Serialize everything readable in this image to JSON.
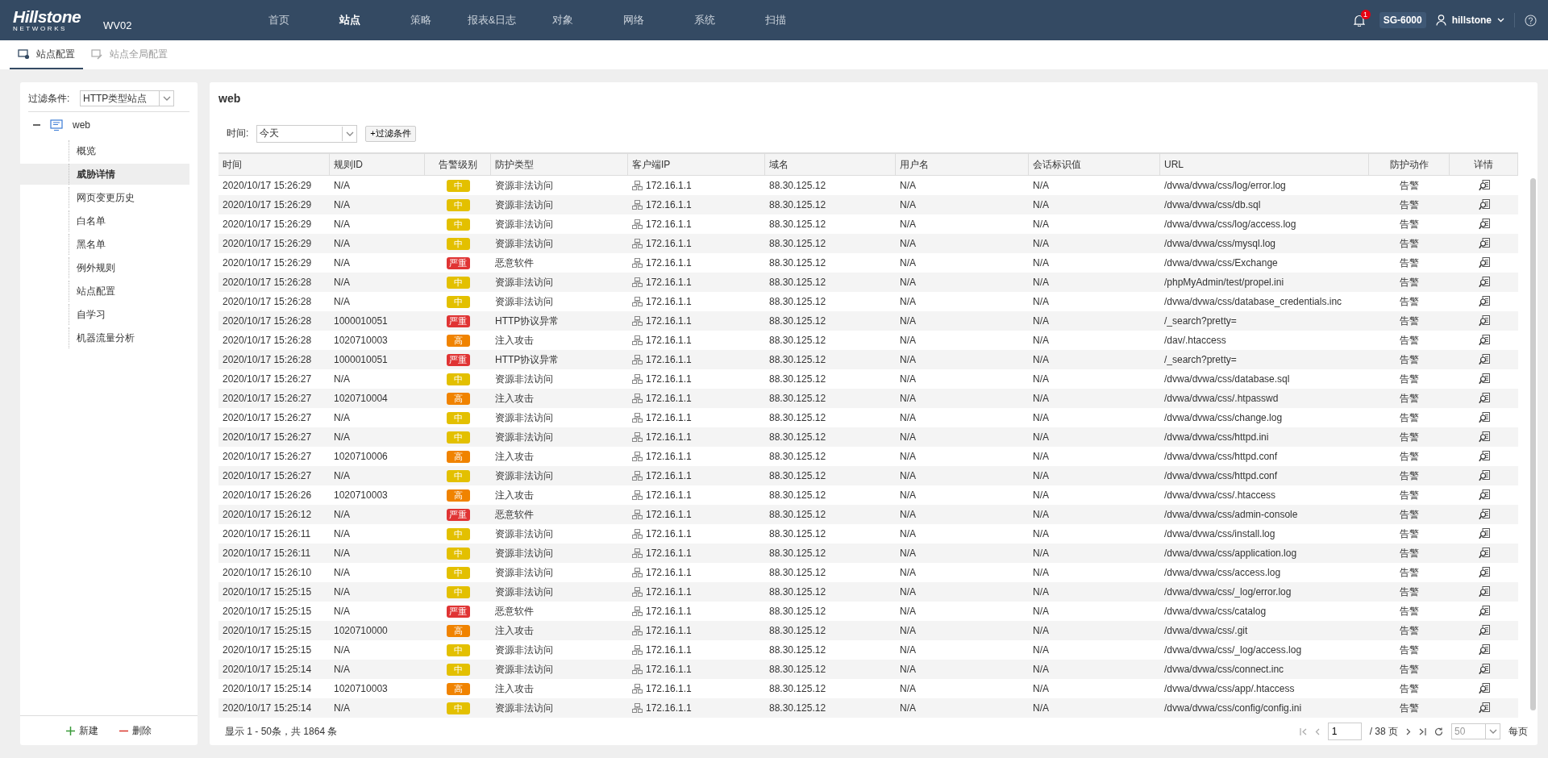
{
  "header": {
    "logo": "Hillstone",
    "logo_sub": "NETWORKS",
    "device": "WV02",
    "nav": [
      {
        "label": "首页",
        "selected": false
      },
      {
        "label": "站点",
        "selected": true
      },
      {
        "label": "策略",
        "selected": false
      },
      {
        "label": "报表&日志",
        "selected": false
      },
      {
        "label": "对象",
        "selected": false
      },
      {
        "label": "网络",
        "selected": false
      },
      {
        "label": "系统",
        "selected": false
      },
      {
        "label": "扫描",
        "selected": false
      }
    ],
    "notification_count": "1",
    "model": "SG-6000",
    "user": "hillstone"
  },
  "tabs": [
    {
      "label": "站点配置",
      "selected": true
    },
    {
      "label": "站点全局配置",
      "selected": false
    }
  ],
  "sidebar": {
    "filter_label": "过滤条件:",
    "filter_value": "HTTP类型站点",
    "tree": [
      {
        "label": "web",
        "expanded": true,
        "children": [
          {
            "label": "概览",
            "selected": false
          },
          {
            "label": "威胁详情",
            "selected": true
          },
          {
            "label": "网页变更历史",
            "selected": false
          },
          {
            "label": "白名单",
            "selected": false
          },
          {
            "label": "黑名单",
            "selected": false
          },
          {
            "label": "例外规则",
            "selected": false
          },
          {
            "label": "站点配置",
            "selected": false
          },
          {
            "label": "自学习",
            "selected": false
          },
          {
            "label": "机器流量分析",
            "selected": false
          }
        ]
      }
    ],
    "actions": [
      "新建",
      "删除"
    ]
  },
  "main": {
    "title": "web",
    "time_label": "时间:",
    "time_value": "今天",
    "add_filter": "+过滤条件",
    "table": {
      "columns": [
        "时间",
        "规则ID",
        "告警级别",
        "防护类型",
        "客户端IP",
        "域名",
        "用户名",
        "会话标识值",
        "URL",
        "防护动作",
        "详情"
      ],
      "rows": [
        {
          "time": "2020/10/17 15:26:29",
          "rule_id": "N/A",
          "alert": {
            "label": "中",
            "color": "#e3c000"
          },
          "type": "资源非法访问",
          "ip": "172.16.1.1",
          "domain": "88.30.125.12",
          "user": "N/A",
          "session": "N/A",
          "url": "/dvwa/dvwa/css/log/error.log",
          "action": "告警"
        },
        {
          "time": "2020/10/17 15:26:29",
          "rule_id": "N/A",
          "alert": {
            "label": "中",
            "color": "#e3c000"
          },
          "type": "资源非法访问",
          "ip": "172.16.1.1",
          "domain": "88.30.125.12",
          "user": "N/A",
          "session": "N/A",
          "url": "/dvwa/dvwa/css/db.sql",
          "action": "告警"
        },
        {
          "time": "2020/10/17 15:26:29",
          "rule_id": "N/A",
          "alert": {
            "label": "中",
            "color": "#e3c000"
          },
          "type": "资源非法访问",
          "ip": "172.16.1.1",
          "domain": "88.30.125.12",
          "user": "N/A",
          "session": "N/A",
          "url": "/dvwa/dvwa/css/log/access.log",
          "action": "告警"
        },
        {
          "time": "2020/10/17 15:26:29",
          "rule_id": "N/A",
          "alert": {
            "label": "中",
            "color": "#e3c000"
          },
          "type": "资源非法访问",
          "ip": "172.16.1.1",
          "domain": "88.30.125.12",
          "user": "N/A",
          "session": "N/A",
          "url": "/dvwa/dvwa/css/mysql.log",
          "action": "告警"
        },
        {
          "time": "2020/10/17 15:26:29",
          "rule_id": "N/A",
          "alert": {
            "label": "严重",
            "color": "#e03434"
          },
          "type": "恶意软件",
          "ip": "172.16.1.1",
          "domain": "88.30.125.12",
          "user": "N/A",
          "session": "N/A",
          "url": "/dvwa/dvwa/css/Exchange",
          "action": "告警"
        },
        {
          "time": "2020/10/17 15:26:28",
          "rule_id": "N/A",
          "alert": {
            "label": "中",
            "color": "#e3c000"
          },
          "type": "资源非法访问",
          "ip": "172.16.1.1",
          "domain": "88.30.125.12",
          "user": "N/A",
          "session": "N/A",
          "url": "/phpMyAdmin/test/propel.ini",
          "action": "告警"
        },
        {
          "time": "2020/10/17 15:26:28",
          "rule_id": "N/A",
          "alert": {
            "label": "中",
            "color": "#e3c000"
          },
          "type": "资源非法访问",
          "ip": "172.16.1.1",
          "domain": "88.30.125.12",
          "user": "N/A",
          "session": "N/A",
          "url": "/dvwa/dvwa/css/database_credentials.inc",
          "action": "告警"
        },
        {
          "time": "2020/10/17 15:26:28",
          "rule_id": "1000010051",
          "alert": {
            "label": "严重",
            "color": "#e03434"
          },
          "type": "HTTP协议异常",
          "ip": "172.16.1.1",
          "domain": "88.30.125.12",
          "user": "N/A",
          "session": "N/A",
          "url": "/_search?pretty=",
          "action": "告警"
        },
        {
          "time": "2020/10/17 15:26:28",
          "rule_id": "1020710003",
          "alert": {
            "label": "高",
            "color": "#f08300"
          },
          "type": "注入攻击",
          "ip": "172.16.1.1",
          "domain": "88.30.125.12",
          "user": "N/A",
          "session": "N/A",
          "url": "/dav/.htaccess",
          "action": "告警"
        },
        {
          "time": "2020/10/17 15:26:28",
          "rule_id": "1000010051",
          "alert": {
            "label": "严重",
            "color": "#e03434"
          },
          "type": "HTTP协议异常",
          "ip": "172.16.1.1",
          "domain": "88.30.125.12",
          "user": "N/A",
          "session": "N/A",
          "url": "/_search?pretty=",
          "action": "告警"
        },
        {
          "time": "2020/10/17 15:26:27",
          "rule_id": "N/A",
          "alert": {
            "label": "中",
            "color": "#e3c000"
          },
          "type": "资源非法访问",
          "ip": "172.16.1.1",
          "domain": "88.30.125.12",
          "user": "N/A",
          "session": "N/A",
          "url": "/dvwa/dvwa/css/database.sql",
          "action": "告警"
        },
        {
          "time": "2020/10/17 15:26:27",
          "rule_id": "1020710004",
          "alert": {
            "label": "高",
            "color": "#f08300"
          },
          "type": "注入攻击",
          "ip": "172.16.1.1",
          "domain": "88.30.125.12",
          "user": "N/A",
          "session": "N/A",
          "url": "/dvwa/dvwa/css/.htpasswd",
          "action": "告警"
        },
        {
          "time": "2020/10/17 15:26:27",
          "rule_id": "N/A",
          "alert": {
            "label": "中",
            "color": "#e3c000"
          },
          "type": "资源非法访问",
          "ip": "172.16.1.1",
          "domain": "88.30.125.12",
          "user": "N/A",
          "session": "N/A",
          "url": "/dvwa/dvwa/css/change.log",
          "action": "告警"
        },
        {
          "time": "2020/10/17 15:26:27",
          "rule_id": "N/A",
          "alert": {
            "label": "中",
            "color": "#e3c000"
          },
          "type": "资源非法访问",
          "ip": "172.16.1.1",
          "domain": "88.30.125.12",
          "user": "N/A",
          "session": "N/A",
          "url": "/dvwa/dvwa/css/httpd.ini",
          "action": "告警"
        },
        {
          "time": "2020/10/17 15:26:27",
          "rule_id": "1020710006",
          "alert": {
            "label": "高",
            "color": "#f08300"
          },
          "type": "注入攻击",
          "ip": "172.16.1.1",
          "domain": "88.30.125.12",
          "user": "N/A",
          "session": "N/A",
          "url": "/dvwa/dvwa/css/httpd.conf",
          "action": "告警"
        },
        {
          "time": "2020/10/17 15:26:27",
          "rule_id": "N/A",
          "alert": {
            "label": "中",
            "color": "#e3c000"
          },
          "type": "资源非法访问",
          "ip": "172.16.1.1",
          "domain": "88.30.125.12",
          "user": "N/A",
          "session": "N/A",
          "url": "/dvwa/dvwa/css/httpd.conf",
          "action": "告警"
        },
        {
          "time": "2020/10/17 15:26:26",
          "rule_id": "1020710003",
          "alert": {
            "label": "高",
            "color": "#f08300"
          },
          "type": "注入攻击",
          "ip": "172.16.1.1",
          "domain": "88.30.125.12",
          "user": "N/A",
          "session": "N/A",
          "url": "/dvwa/dvwa/css/.htaccess",
          "action": "告警"
        },
        {
          "time": "2020/10/17 15:26:12",
          "rule_id": "N/A",
          "alert": {
            "label": "严重",
            "color": "#e03434"
          },
          "type": "恶意软件",
          "ip": "172.16.1.1",
          "domain": "88.30.125.12",
          "user": "N/A",
          "session": "N/A",
          "url": "/dvwa/dvwa/css/admin-console",
          "action": "告警"
        },
        {
          "time": "2020/10/17 15:26:11",
          "rule_id": "N/A",
          "alert": {
            "label": "中",
            "color": "#e3c000"
          },
          "type": "资源非法访问",
          "ip": "172.16.1.1",
          "domain": "88.30.125.12",
          "user": "N/A",
          "session": "N/A",
          "url": "/dvwa/dvwa/css/install.log",
          "action": "告警"
        },
        {
          "time": "2020/10/17 15:26:11",
          "rule_id": "N/A",
          "alert": {
            "label": "中",
            "color": "#e3c000"
          },
          "type": "资源非法访问",
          "ip": "172.16.1.1",
          "domain": "88.30.125.12",
          "user": "N/A",
          "session": "N/A",
          "url": "/dvwa/dvwa/css/application.log",
          "action": "告警"
        },
        {
          "time": "2020/10/17 15:26:10",
          "rule_id": "N/A",
          "alert": {
            "label": "中",
            "color": "#e3c000"
          },
          "type": "资源非法访问",
          "ip": "172.16.1.1",
          "domain": "88.30.125.12",
          "user": "N/A",
          "session": "N/A",
          "url": "/dvwa/dvwa/css/access.log",
          "action": "告警"
        },
        {
          "time": "2020/10/17 15:25:15",
          "rule_id": "N/A",
          "alert": {
            "label": "中",
            "color": "#e3c000"
          },
          "type": "资源非法访问",
          "ip": "172.16.1.1",
          "domain": "88.30.125.12",
          "user": "N/A",
          "session": "N/A",
          "url": "/dvwa/dvwa/css/_log/error.log",
          "action": "告警"
        },
        {
          "time": "2020/10/17 15:25:15",
          "rule_id": "N/A",
          "alert": {
            "label": "严重",
            "color": "#e03434"
          },
          "type": "恶意软件",
          "ip": "172.16.1.1",
          "domain": "88.30.125.12",
          "user": "N/A",
          "session": "N/A",
          "url": "/dvwa/dvwa/css/catalog",
          "action": "告警"
        },
        {
          "time": "2020/10/17 15:25:15",
          "rule_id": "1020710000",
          "alert": {
            "label": "高",
            "color": "#f08300"
          },
          "type": "注入攻击",
          "ip": "172.16.1.1",
          "domain": "88.30.125.12",
          "user": "N/A",
          "session": "N/A",
          "url": "/dvwa/dvwa/css/.git",
          "action": "告警"
        },
        {
          "time": "2020/10/17 15:25:15",
          "rule_id": "N/A",
          "alert": {
            "label": "中",
            "color": "#e3c000"
          },
          "type": "资源非法访问",
          "ip": "172.16.1.1",
          "domain": "88.30.125.12",
          "user": "N/A",
          "session": "N/A",
          "url": "/dvwa/dvwa/css/_log/access.log",
          "action": "告警"
        },
        {
          "time": "2020/10/17 15:25:14",
          "rule_id": "N/A",
          "alert": {
            "label": "中",
            "color": "#e3c000"
          },
          "type": "资源非法访问",
          "ip": "172.16.1.1",
          "domain": "88.30.125.12",
          "user": "N/A",
          "session": "N/A",
          "url": "/dvwa/dvwa/css/connect.inc",
          "action": "告警"
        },
        {
          "time": "2020/10/17 15:25:14",
          "rule_id": "1020710003",
          "alert": {
            "label": "高",
            "color": "#f08300"
          },
          "type": "注入攻击",
          "ip": "172.16.1.1",
          "domain": "88.30.125.12",
          "user": "N/A",
          "session": "N/A",
          "url": "/dvwa/dvwa/css/app/.htaccess",
          "action": "告警"
        },
        {
          "time": "2020/10/17 15:25:14",
          "rule_id": "N/A",
          "alert": {
            "label": "中",
            "color": "#e3c000"
          },
          "type": "资源非法访问",
          "ip": "172.16.1.1",
          "domain": "88.30.125.12",
          "user": "N/A",
          "session": "N/A",
          "url": "/dvwa/dvwa/css/config/config.ini",
          "action": "告警"
        }
      ]
    },
    "summary": "显示 1 - 50条，共 1864 条",
    "pagination": {
      "page": "1",
      "total_pages": "/ 38 页",
      "page_size": "50",
      "per_page_label": "每页"
    }
  }
}
